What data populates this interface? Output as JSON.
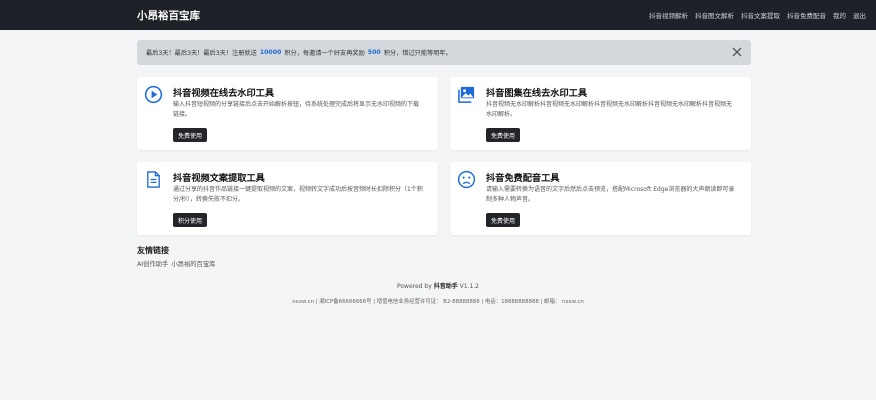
{
  "navbar": {
    "brand": "小昂裕百宝库",
    "links": [
      "抖音视频解析",
      "抖音图文解析",
      "抖音文案提取",
      "抖音免费配音",
      "我的",
      "退出"
    ]
  },
  "alert": {
    "text_1": "最后3天！最后3天！最后3天！注册就送",
    "highlight_1": "10000",
    "text_2": "积分，每邀请一个好友再奖励",
    "highlight_2": "500",
    "text_3": "积分，错过只能等明年。",
    "close_icon": "close-icon"
  },
  "cards": [
    {
      "icon": "play-circle-icon",
      "title": "抖音视频在线去水印工具",
      "desc": "输入抖音短视频的分享链接后点击开始解析按钮，待系统处理完成后将显示无水印视频的下载链接。",
      "button": "免费使用"
    },
    {
      "icon": "image-gallery-icon",
      "title": "抖音图集在线去水印工具",
      "desc": "抖音视频无水印解析抖音视频无水印解析抖音视频无水印解析抖音视频无水印解析抖音视频无水印解析。",
      "button": "免费使用"
    },
    {
      "icon": "document-icon",
      "title": "抖音视频文案提取工具",
      "desc": "通过分享的抖音作品链接一键提取视频的文案，视频转文字成功后按音频时长扣除积分（1个积分/秒），转换失败不扣分。",
      "button": "积分使用"
    },
    {
      "icon": "sad-face-icon",
      "title": "抖音免费配音工具",
      "desc": "请输入需要转换为语音的文字后然后点击预览，搭配Microsoft Edge浏览器的大声朗读即可录制多种人物声音。",
      "button": "免费使用"
    }
  ],
  "friend_links": {
    "title": "友情链接",
    "items": [
      "AI创作助手",
      "小昂裕的百宝库"
    ]
  },
  "footer": {
    "powered_prefix": "Powered by",
    "powered_name": "抖音助手",
    "version": "V1.1.2",
    "info": "nxxw.cn | 湘ICP备66666666号 | 增值电信业务经营许可证： B2-88888888 | 电话：18888888888 | 邮箱： nxxw.cn"
  },
  "colors": {
    "navbar_bg": "#1f2128",
    "accent_blue": "#1e6ad8",
    "button_bg": "#23252b",
    "page_bg": "#f4f5f7",
    "alert_bg": "#d4d7dc"
  }
}
